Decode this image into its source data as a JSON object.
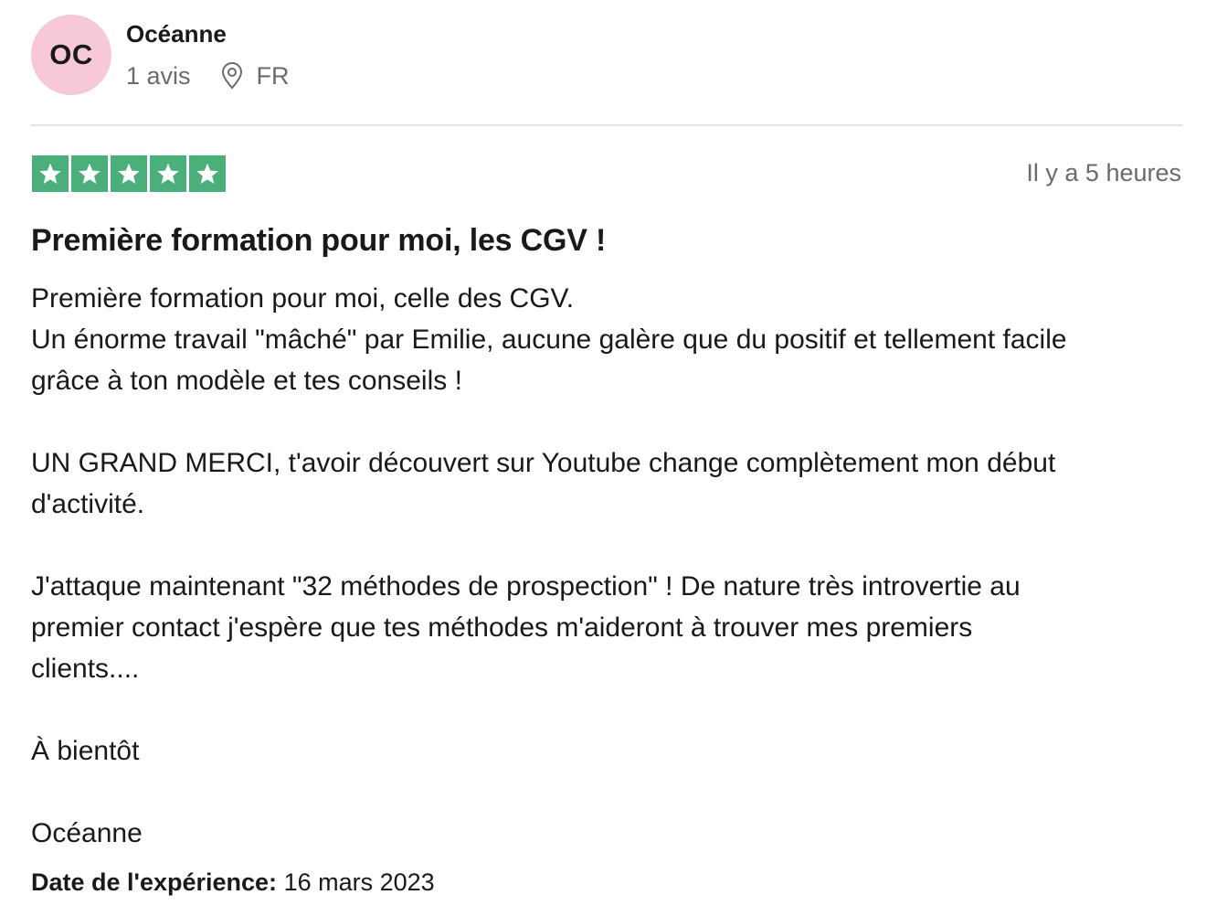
{
  "reviewer": {
    "initials": "OC",
    "name": "Océanne",
    "review_count": "1 avis",
    "country": "FR",
    "avatar_color": "#f7c9d6"
  },
  "review": {
    "rating": 5,
    "rating_max": 5,
    "star_color": "#4aaf7a",
    "time_ago": "Il y a 5 heures",
    "title": "Première formation pour moi, les CGV !",
    "paragraphs": [
      [
        "Première formation pour moi, celle des CGV.",
        "Un énorme travail \"mâché\" par Emilie, aucune galère que du positif et tellement facile",
        "grâce à ton modèle et tes conseils !"
      ],
      [
        "UN GRAND MERCI, t'avoir découvert sur Youtube change complètement mon début",
        "d'activité."
      ],
      [
        "J'attaque maintenant \"32 méthodes de prospection\" ! De nature très introvertie au",
        "premier contact j'espère que tes méthodes m'aideront à trouver mes premiers",
        "clients...."
      ],
      [
        "À bientôt"
      ],
      [
        "Océanne"
      ]
    ],
    "experience_label": "Date de l'expérience:",
    "experience_date": "16 mars 2023"
  },
  "icons": {
    "location": "location-pin-icon",
    "star": "star-icon"
  }
}
